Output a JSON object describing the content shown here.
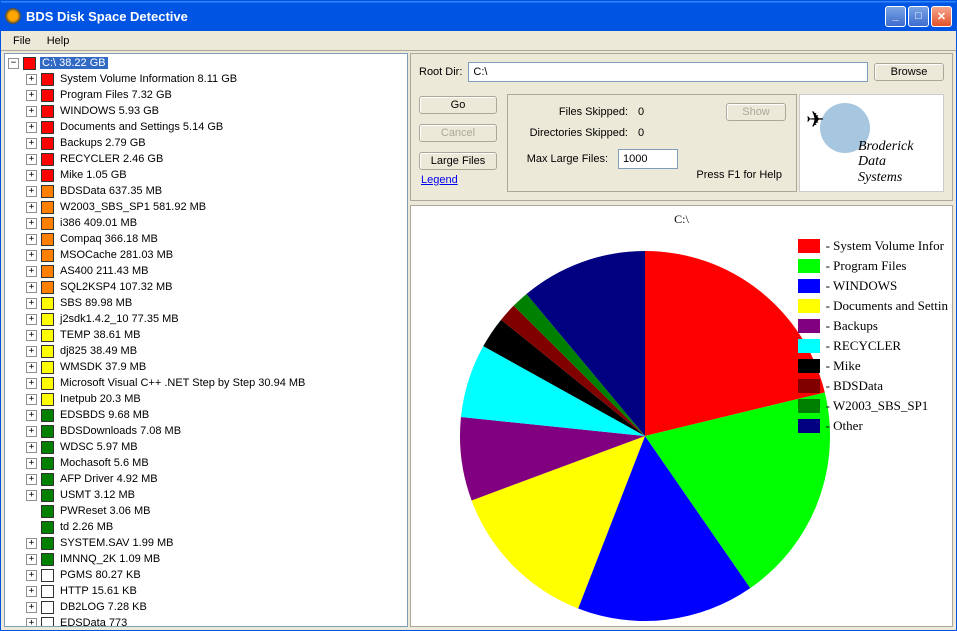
{
  "window": {
    "title": "BDS Disk Space Detective"
  },
  "menu": {
    "file": "File",
    "help": "Help"
  },
  "tree": {
    "root": {
      "label": "C:\\ 38.22 GB",
      "color": "#ff0000",
      "expanded": true
    },
    "items": [
      {
        "label": "System Volume Information 8.11 GB",
        "color": "#ff0000",
        "exp": "+"
      },
      {
        "label": "Program Files 7.32 GB",
        "color": "#ff0000",
        "exp": "+"
      },
      {
        "label": "WINDOWS 5.93 GB",
        "color": "#ff0000",
        "exp": "+"
      },
      {
        "label": "Documents and Settings 5.14 GB",
        "color": "#ff0000",
        "exp": "+"
      },
      {
        "label": "Backups 2.79 GB",
        "color": "#ff0000",
        "exp": "+"
      },
      {
        "label": "RECYCLER 2.46 GB",
        "color": "#ff0000",
        "exp": "+"
      },
      {
        "label": "Mike 1.05 GB",
        "color": "#ff0000",
        "exp": "+"
      },
      {
        "label": "BDSData 637.35 MB",
        "color": "#ff8000",
        "exp": "+"
      },
      {
        "label": "W2003_SBS_SP1 581.92 MB",
        "color": "#ff8000",
        "exp": "+"
      },
      {
        "label": "i386 409.01 MB",
        "color": "#ff8000",
        "exp": "+"
      },
      {
        "label": "Compaq 366.18 MB",
        "color": "#ff8000",
        "exp": "+"
      },
      {
        "label": "MSOCache 281.03 MB",
        "color": "#ff8000",
        "exp": "+"
      },
      {
        "label": "AS400 211.43 MB",
        "color": "#ff8000",
        "exp": "+"
      },
      {
        "label": "SQL2KSP4 107.32 MB",
        "color": "#ff8000",
        "exp": "+"
      },
      {
        "label": "SBS 89.98 MB",
        "color": "#ffff00",
        "exp": "+"
      },
      {
        "label": "j2sdk1.4.2_10 77.35 MB",
        "color": "#ffff00",
        "exp": "+"
      },
      {
        "label": "TEMP 38.61 MB",
        "color": "#ffff00",
        "exp": "+"
      },
      {
        "label": "dj825 38.49 MB",
        "color": "#ffff00",
        "exp": "+"
      },
      {
        "label": "WMSDK 37.9 MB",
        "color": "#ffff00",
        "exp": "+"
      },
      {
        "label": "Microsoft Visual C++ .NET Step by Step 30.94 MB",
        "color": "#ffff00",
        "exp": "+"
      },
      {
        "label": "Inetpub 20.3 MB",
        "color": "#ffff00",
        "exp": "+"
      },
      {
        "label": "EDSBDS 9.68 MB",
        "color": "#008000",
        "exp": "+"
      },
      {
        "label": "BDSDownloads 7.08 MB",
        "color": "#008000",
        "exp": "+"
      },
      {
        "label": "WDSC 5.97 MB",
        "color": "#008000",
        "exp": "+"
      },
      {
        "label": "Mochasoft 5.6 MB",
        "color": "#008000",
        "exp": "+"
      },
      {
        "label": "AFP Driver 4.92 MB",
        "color": "#008000",
        "exp": "+"
      },
      {
        "label": "USMT 3.12 MB",
        "color": "#008000",
        "exp": "+"
      },
      {
        "label": "PWReset 3.06 MB",
        "color": "#008000",
        "exp": ""
      },
      {
        "label": "td 2.26 MB",
        "color": "#008000",
        "exp": ""
      },
      {
        "label": "SYSTEM.SAV 1.99 MB",
        "color": "#008000",
        "exp": "+"
      },
      {
        "label": "IMNNQ_2K 1.09 MB",
        "color": "#008000",
        "exp": "+"
      },
      {
        "label": "PGMS 80.27 KB",
        "color": "#ffffff",
        "exp": "+"
      },
      {
        "label": "HTTP 15.61 KB",
        "color": "#ffffff",
        "exp": "+"
      },
      {
        "label": "DB2LOG 7.28 KB",
        "color": "#ffffff",
        "exp": "+"
      },
      {
        "label": "EDSData 773",
        "color": "#ffffff",
        "exp": "+"
      }
    ]
  },
  "controls": {
    "root_dir_label": "Root Dir:",
    "root_dir_value": "C:\\",
    "browse": "Browse",
    "go": "Go",
    "cancel": "Cancel",
    "large_files": "Large Files",
    "files_skipped_label": "Files Skipped:",
    "files_skipped_value": "0",
    "dirs_skipped_label": "Directories Skipped:",
    "dirs_skipped_value": "0",
    "show": "Show",
    "max_large_label": "Max Large Files:",
    "max_large_value": "1000",
    "help_hint": "Press F1 for Help",
    "legend": "Legend",
    "logo_text": "Broderick\nData\nSystems"
  },
  "chart_data": {
    "type": "pie",
    "title": "C:\\",
    "series": [
      {
        "name": "System Volume Infor",
        "value": 8.11,
        "color": "#ff0000"
      },
      {
        "name": "Program Files",
        "value": 7.32,
        "color": "#00ff00"
      },
      {
        "name": "WINDOWS",
        "value": 5.93,
        "color": "#0000ff"
      },
      {
        "name": "Documents and Settin",
        "value": 5.14,
        "color": "#ffff00"
      },
      {
        "name": "Backups",
        "value": 2.79,
        "color": "#800080"
      },
      {
        "name": "RECYCLER",
        "value": 2.46,
        "color": "#00ffff"
      },
      {
        "name": "Mike",
        "value": 1.05,
        "color": "#000000"
      },
      {
        "name": "BDSData",
        "value": 0.62,
        "color": "#800000"
      },
      {
        "name": "W2003_SBS_SP1",
        "value": 0.57,
        "color": "#008000"
      },
      {
        "name": "Other",
        "value": 4.23,
        "color": "#000080"
      }
    ]
  }
}
